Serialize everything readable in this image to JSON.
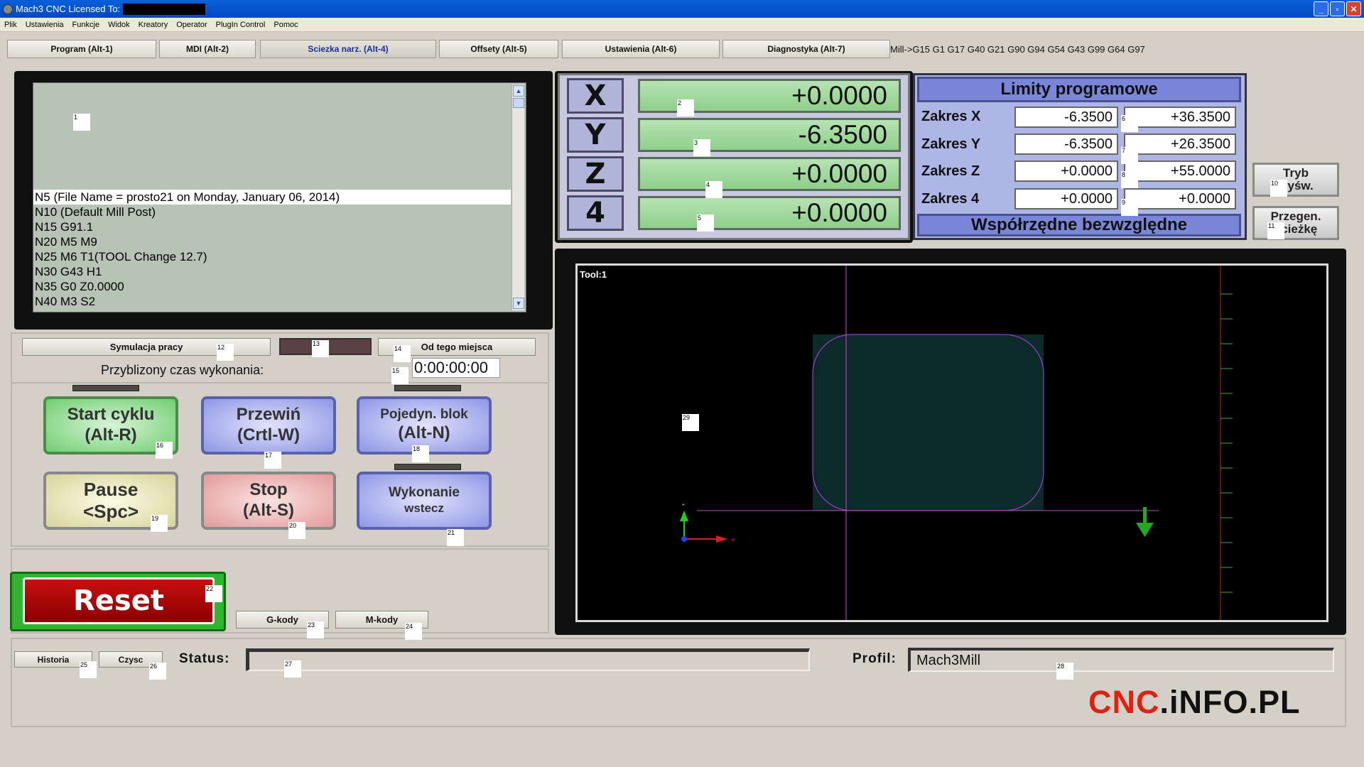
{
  "window": {
    "title": "Mach3 CNC  Licensed To:"
  },
  "menu": [
    "Plik",
    "Ustawienia",
    "Funkcje",
    "Widok",
    "Kreatory",
    "Operator",
    "PlugIn Control",
    "Pomoc"
  ],
  "tabs": [
    "Program (Alt-1)",
    "MDI (Alt-2)",
    "Sciezka narz. (Alt-4)",
    "Offsety (Alt-5)",
    "Ustawienia (Alt-6)",
    "Diagnostyka (Alt-7)"
  ],
  "modal_line": "Mill->G15  G1 G17 G40 G21 G90 G94 G54 G43 G99 G64 G97",
  "gcode": {
    "lines": [
      "N5 (File Name = prosto21 on Monday, January 06, 2014)",
      "N10 (Default Mill Post)",
      "N15  G91.1",
      "N20 M5 M9",
      "N25 M6 T1(TOOL Change 12.7)",
      "N30 G43 H1",
      "N35 G0  Z0.0000",
      "N40 M3 S2"
    ]
  },
  "sim": {
    "simulate_label": "Symulacja pracy",
    "from_here_label": "Od tego miejsca",
    "time_label": "Przyblizony czas wykonania:",
    "time_value": "0:00:00:00"
  },
  "buttons": {
    "start": [
      "Start cyklu",
      "(Alt-R)"
    ],
    "rewind": [
      "Przewiń",
      "(Crtl-W)"
    ],
    "single": [
      "Pojedyn. blok",
      "(Alt-N)"
    ],
    "pause": [
      "Pause",
      "<Spc>"
    ],
    "stop": [
      "Stop",
      "(Alt-S)"
    ],
    "reverse": [
      "Wykonanie",
      "wstecz"
    ],
    "reset": "Reset",
    "gcodes": "G-kody",
    "mcodes": "M-kody",
    "history": "Historia",
    "clear": "Czysc"
  },
  "dro": {
    "axes": [
      "X",
      "Y",
      "Z",
      "4"
    ],
    "values": [
      "+0.0000",
      "-6.3500",
      "+0.0000",
      "+0.0000"
    ]
  },
  "limits": {
    "title": "Limity programowe",
    "rows": [
      {
        "label": "Zakres X",
        "min": "-6.3500",
        "max": "+36.3500"
      },
      {
        "label": "Zakres Y",
        "min": "-6.3500",
        "max": "+26.3500"
      },
      {
        "label": "Zakres Z",
        "min": "+0.0000",
        "max": "+55.0000"
      },
      {
        "label": "Zakres 4",
        "min": "+0.0000",
        "max": "+0.0000"
      }
    ],
    "abs_label": "Współrzędne bezwzględne"
  },
  "side": {
    "mode": [
      "Tryb",
      "wyśw."
    ],
    "regen": [
      "Przegen.",
      "ścieżkę"
    ]
  },
  "toolpath": {
    "tool_label": "Tool:1"
  },
  "status": {
    "label": "Status:",
    "value": ""
  },
  "profile": {
    "label": "Profil:",
    "value": "Mach3Mill"
  },
  "brand": {
    "part1": "CNC",
    "part2": ".iNFO.PL"
  },
  "markers": [
    "1",
    "2",
    "3",
    "4",
    "5",
    "6",
    "7",
    "8",
    "9",
    "10",
    "11",
    "12",
    "13",
    "14",
    "15",
    "16",
    "17",
    "18",
    "19",
    "20",
    "21",
    "22",
    "23",
    "24",
    "25",
    "26",
    "27",
    "28",
    "29"
  ],
  "colors": {
    "title_bar": "#0348c2",
    "dro_green": "#8ecf8b",
    "reset_red": "#c81010",
    "brand_red": "#e02010"
  }
}
